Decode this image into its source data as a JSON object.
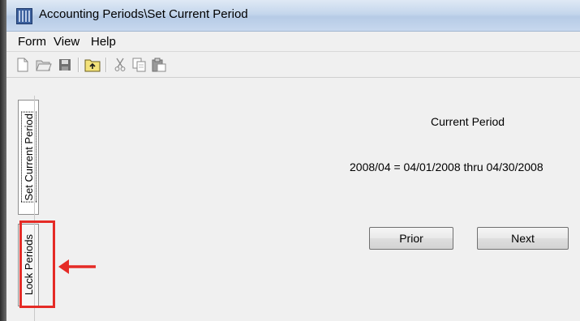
{
  "window": {
    "title": "Accounting Periods\\Set Current Period",
    "icon": "app-grid-icon"
  },
  "menu": {
    "items": [
      "Form",
      "View",
      "Help"
    ]
  },
  "toolbar": {
    "icons": [
      "new-document-icon",
      "open-folder-icon",
      "save-icon",
      "up-folder-icon",
      "cut-icon",
      "copy-icon",
      "paste-icon"
    ]
  },
  "tabs": [
    {
      "label": "Set Current Period",
      "active": true
    },
    {
      "label": "Lock Periods",
      "active": false
    }
  ],
  "content": {
    "heading": "Current Period",
    "period_range": "2008/04 = 04/01/2008 thru 04/30/2008",
    "prior_label": "Prior",
    "next_label": "Next"
  },
  "annotation": {
    "color": "#e52b26",
    "target": "Lock Periods"
  },
  "colors": {
    "window_bg": "#f0f0f0",
    "titlebar": "#c4d6ec",
    "highlight": "#e52b26"
  }
}
